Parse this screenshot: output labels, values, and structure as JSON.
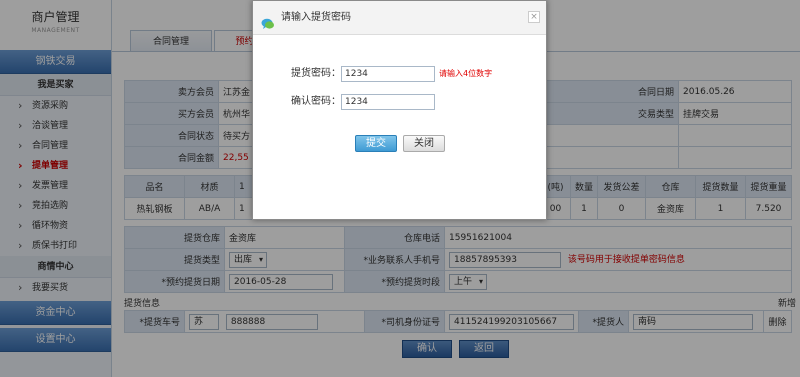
{
  "sidebar": {
    "title": "商户管理",
    "subtitle": "MANAGEMENT",
    "steel_label": "钢铁交易",
    "buyer_group": "我是买家",
    "buyer_items": [
      "资源采购",
      "洽谈管理",
      "合同管理",
      "提单管理",
      "发票管理",
      "竞拍选购",
      "循环物资",
      "质保书打印"
    ],
    "info_group": "商情中心",
    "info_items": [
      "我要买货"
    ],
    "fund_label": "资金中心",
    "settings_label": "设置中心"
  },
  "tabs": [
    "合同管理",
    "预约提"
  ],
  "contract": {
    "seller_label": "卖方会员",
    "seller_value": "江苏金",
    "buyer_label": "买方会员",
    "buyer_value": "杭州华",
    "status_label": "合同状态",
    "status_value": "待买方",
    "amount_label": "合同金额",
    "amount_value": "22,55",
    "date_label": "合同日期",
    "date_value": "2016.05.26",
    "type_label": "交易类型",
    "type_value": "挂牌交易"
  },
  "goods": {
    "headers": [
      "品名",
      "材质",
      "1",
      "(吨)",
      "数量",
      "发货公差",
      "仓库",
      "提货数量",
      "提货重量"
    ],
    "row": [
      "热轧钢板",
      "AB/A",
      "1",
      "00",
      "1",
      "0",
      "金资库",
      "1",
      "7.520"
    ]
  },
  "pickup": {
    "warehouse_label": "提货仓库",
    "warehouse_value": "金资库",
    "phone_label": "仓库电话",
    "phone_value": "15951621004",
    "ptype_label": "提货类型",
    "ptype_value": "出库",
    "mobile_label": "*业务联系人手机号",
    "mobile_value": "18857895393",
    "mobile_hint": "该号码用于接收提单密码信息",
    "date_label": "*预约提货日期",
    "date_value": "2016-05-28",
    "slot_label": "*预约提货时段",
    "slot_value": "上午"
  },
  "pickup_info": {
    "title": "提货信息",
    "add_label": "新增",
    "plate_label": "*提货车号",
    "plate_prefix": "苏",
    "plate_value": "888888",
    "id_label": "*司机身份证号",
    "id_value": "411524199203105667",
    "person_label": "*提货人",
    "person_value": "南码",
    "delete_label": "删除"
  },
  "actions": {
    "confirm": "确认",
    "back": "返回"
  },
  "dialog": {
    "title": "请输入提货密码",
    "close_glyph": "×",
    "pwd_label": "提货密码：",
    "pwd_value": "1234",
    "pwd_hint": "请输入4位数字",
    "confirm_label": "确认密码：",
    "confirm_value": "1234",
    "submit": "提交",
    "close": "关闭"
  }
}
